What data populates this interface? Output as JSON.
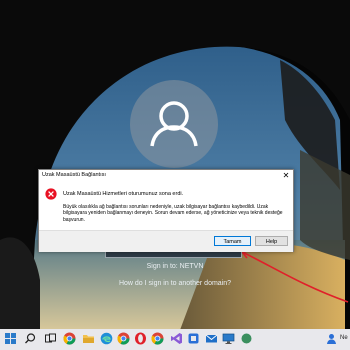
{
  "lock_screen": {
    "signin_to": "Sign in to: NETVN",
    "other_domain": "How do I sign in to another domain?"
  },
  "dialog": {
    "title": "Uzak Masaüstü Bağlantısı",
    "headline": "Uzak Masaüstü Hizmetleri oturumunuz sona erdi.",
    "detail": "Büyük olasılıkla ağ bağlantısı sorunları nedeniyle, uzak bilgisayar bağlantısı kaybedildi. Uzak bilgisayara yeniden bağlanmayı deneyin. Sorun devam ederse, ağ yöneticinize veya teknik desteğe başvurun.",
    "ok_label": "Tamam",
    "help_label": "Help",
    "close_glyph": "✕"
  },
  "taskbar": {
    "label": "Ne",
    "icons": [
      "windows-icon",
      "search-icon",
      "task-view-icon",
      "file-explorer-icon",
      "edge-icon",
      "chrome-icon",
      "mail-icon",
      "visual-studio-code-icon",
      "opera-icon",
      "chrome-icon",
      "chrome-icon",
      "visual-studio-icon",
      "app-icon",
      "remote-desktop-icon",
      "misc-icon"
    ]
  },
  "colors": {
    "accent": "#0078d7",
    "error": "#e81123",
    "annotation": "#e0202a"
  }
}
